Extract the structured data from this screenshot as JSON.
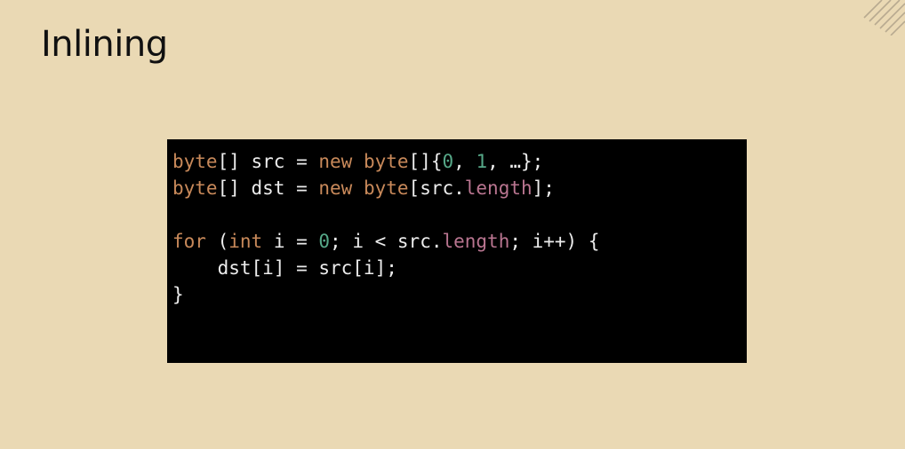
{
  "slide": {
    "title": "Inlining"
  },
  "code": {
    "colors": {
      "keyword": "#c8895a",
      "number": "#56a888",
      "field": "#b97590",
      "plain": "#ececec",
      "background": "#000000"
    },
    "lines": [
      [
        {
          "t": "byte",
          "k": "keyword"
        },
        {
          "t": "[] src = ",
          "k": "plain"
        },
        {
          "t": "new",
          "k": "keyword"
        },
        {
          "t": " ",
          "k": "plain"
        },
        {
          "t": "byte",
          "k": "keyword"
        },
        {
          "t": "[]{",
          "k": "plain"
        },
        {
          "t": "0",
          "k": "number"
        },
        {
          "t": ", ",
          "k": "plain"
        },
        {
          "t": "1",
          "k": "number"
        },
        {
          "t": ", …};",
          "k": "plain"
        }
      ],
      [
        {
          "t": "byte",
          "k": "keyword"
        },
        {
          "t": "[] dst = ",
          "k": "plain"
        },
        {
          "t": "new",
          "k": "keyword"
        },
        {
          "t": " ",
          "k": "plain"
        },
        {
          "t": "byte",
          "k": "keyword"
        },
        {
          "t": "[src.",
          "k": "plain"
        },
        {
          "t": "length",
          "k": "field"
        },
        {
          "t": "];",
          "k": "plain"
        }
      ],
      [],
      [
        {
          "t": "for",
          "k": "keyword"
        },
        {
          "t": " (",
          "k": "plain"
        },
        {
          "t": "int",
          "k": "keyword"
        },
        {
          "t": " i = ",
          "k": "plain"
        },
        {
          "t": "0",
          "k": "number"
        },
        {
          "t": "; i < src.",
          "k": "plain"
        },
        {
          "t": "length",
          "k": "field"
        },
        {
          "t": "; i++) {",
          "k": "plain"
        }
      ],
      [
        {
          "t": "    dst[i] = src[i];",
          "k": "plain"
        }
      ],
      [
        {
          "t": "}",
          "k": "plain"
        }
      ]
    ]
  }
}
